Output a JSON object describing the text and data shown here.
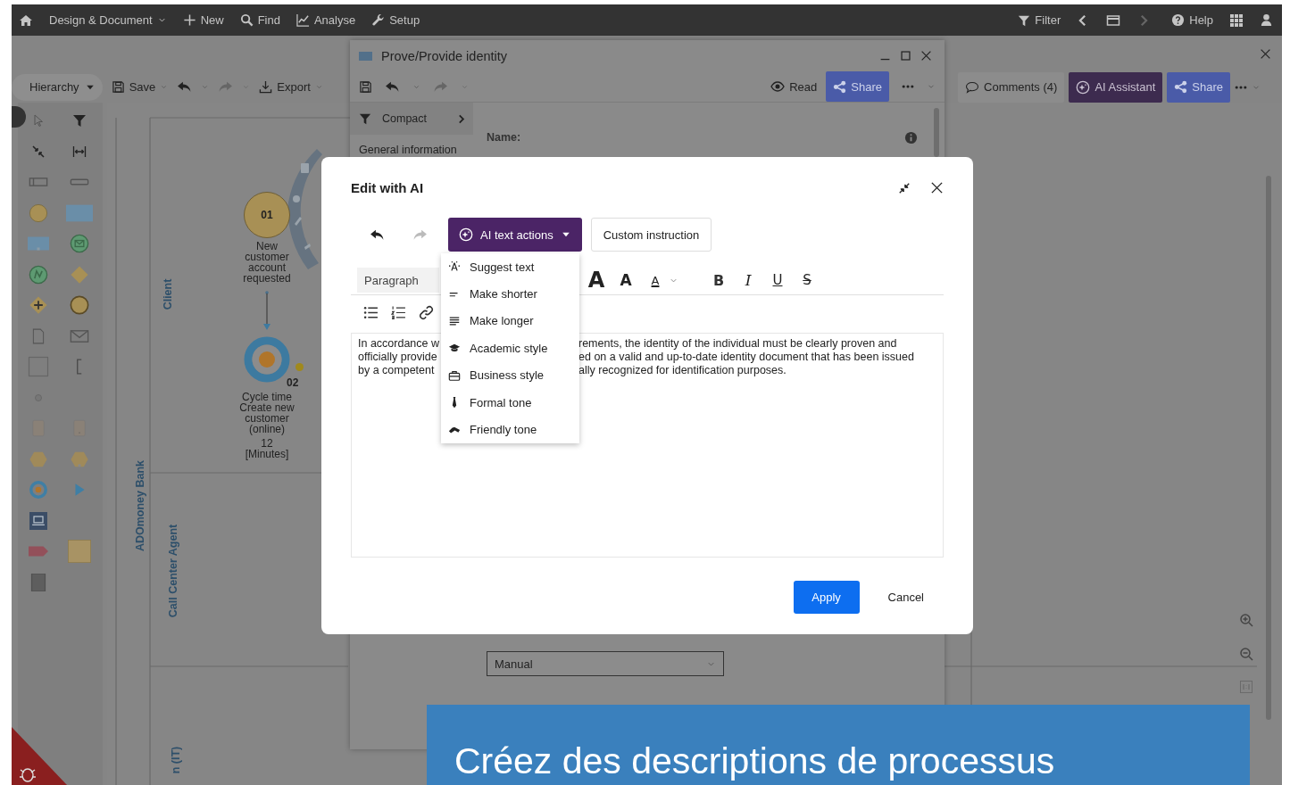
{
  "top_nav": {
    "items": [
      {
        "label": "Design & Document",
        "kind": "dropdown"
      },
      {
        "label": "New",
        "kind": "plus"
      },
      {
        "label": "Find",
        "kind": "search"
      },
      {
        "label": "Analyse",
        "kind": "chart"
      },
      {
        "label": "Setup",
        "kind": "wrench"
      }
    ],
    "filter": "Filter",
    "help": "Help"
  },
  "model_toolbar": {
    "view": "Hierarchy",
    "save": "Save",
    "export": "Export"
  },
  "diagram": {
    "pool": "ADOmoney Bank",
    "lanes": [
      {
        "label": "Client"
      },
      {
        "label": "Call Center Agent"
      },
      {
        "label": "n (IT)"
      }
    ],
    "nodes": [
      {
        "kind": "start",
        "number": "01",
        "label": "New customer account requested"
      },
      {
        "kind": "kpi",
        "number": "02",
        "label": "Cycle time Create new customer (online)",
        "value": "12",
        "unit": "[Minutes]"
      }
    ]
  },
  "object_window": {
    "title": "Prove/Provide identity",
    "read": "Read",
    "share": "Share",
    "compact": "Compact",
    "section": "General information",
    "name_label": "Name:",
    "type_value": "Manual"
  },
  "side_panel": {
    "comments": "Comments (4)",
    "ai": "AI Assistant",
    "share": "Share"
  },
  "dialog": {
    "title": "Edit with AI",
    "undo": {
      "disabled": false
    },
    "redo": {
      "disabled": true
    },
    "ai_actions": "AI text actions",
    "custom": "Custom instruction",
    "menu": [
      {
        "label": "Suggest text",
        "kind": "suggest"
      },
      {
        "label": "Make shorter",
        "kind": "shorter"
      },
      {
        "label": "Make longer",
        "kind": "longer"
      },
      {
        "label": "Academic style",
        "kind": "academic"
      },
      {
        "label": "Business style",
        "kind": "business"
      },
      {
        "label": "Formal tone",
        "kind": "formal"
      },
      {
        "label": "Friendly tone",
        "kind": "friendly"
      }
    ],
    "block_style": "Paragraph",
    "format_buttons": [
      {
        "glyph": "A",
        "kind": "grow"
      },
      {
        "glyph": "A",
        "kind": "shrink"
      },
      {
        "glyph": "A",
        "kind": "color"
      },
      {
        "glyph": "B",
        "kind": "bold"
      },
      {
        "glyph": "I",
        "kind": "italic"
      },
      {
        "glyph": "U",
        "kind": "underline"
      },
      {
        "glyph": "S",
        "kind": "strike"
      }
    ],
    "text_left": [
      "In accordance w",
      "officially provide",
      "by a competent"
    ],
    "text_right": [
      "rements, the identity of the individual must be clearly proven and",
      "ed on a valid and up-to-date identity document that has been issued",
      "ally recognized for identification purposes."
    ],
    "apply": "Apply",
    "cancel": "Cancel"
  },
  "banner": {
    "text": "Créez des descriptions de processus"
  }
}
